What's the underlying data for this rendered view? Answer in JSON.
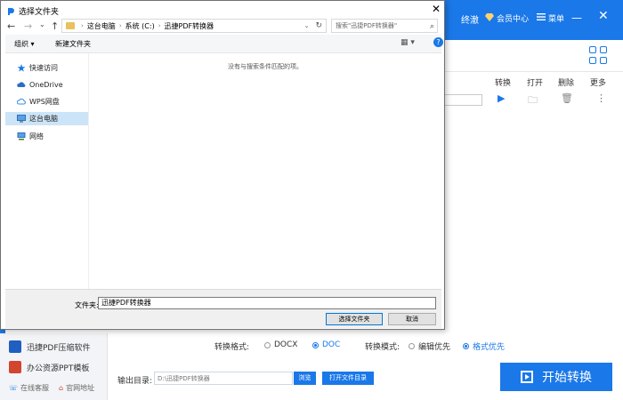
{
  "app": {
    "username": "终澈",
    "vip_label": "会员中心",
    "menu_label": "菜单",
    "minimize_glyph": "—",
    "close_glyph": "✕",
    "columns": [
      "转换",
      "打开",
      "删除",
      "更多"
    ],
    "row_actions": {
      "play": "▶",
      "open_folder": "🗀",
      "delete": "🗑",
      "more": "⋮"
    },
    "promos": [
      "迅捷PDF压缩软件",
      "办公资源PPT模板"
    ],
    "links": [
      "在线客服",
      "官网地址"
    ],
    "convert_format_label": "转换格式:",
    "convert_format_options": [
      {
        "label": "DOCX",
        "selected": false
      },
      {
        "label": "DOC",
        "selected": true
      }
    ],
    "convert_mode_label": "转换模式:",
    "convert_mode_options": [
      {
        "label": "编辑优先",
        "selected": false
      },
      {
        "label": "格式优先",
        "selected": true
      }
    ],
    "output_label": "输出目录:",
    "output_value": "D:\\迅捷PDF转换器",
    "browse_label": "浏览",
    "open_dir_label": "打开文件目录",
    "start_label": "开始转换",
    "accent_color": "#1a78e8"
  },
  "dialog": {
    "title": "选择文件夹",
    "close_glyph": "✕",
    "nav": {
      "back": "←",
      "forward": "→",
      "dropdown": "⌄",
      "up": "↑"
    },
    "breadcrumb": [
      "这台电脑",
      "系统 (C:)",
      "迅捷PDF转换器"
    ],
    "refresh_glyph": "↻",
    "search_placeholder": "搜索\"迅捷PDF转换器\"",
    "search_glyph": "⌕",
    "organize_label": "组织 ▾",
    "new_folder_label": "新建文件夹",
    "view_glyph": "▦ ▾",
    "help_glyph": "?",
    "nav_items": [
      {
        "label": "快速访问",
        "icon": "star-icon"
      },
      {
        "label": "OneDrive",
        "icon": "cloud-icon"
      },
      {
        "label": "WPS网盘",
        "icon": "wps-cloud-icon"
      },
      {
        "label": "这台电脑",
        "icon": "computer-icon"
      },
      {
        "label": "网络",
        "icon": "network-icon"
      }
    ],
    "empty_message": "没有与搜索条件匹配的项。",
    "filename_label": "文件夹:",
    "filename_value": "迅捷PDF转换器",
    "select_button": "选择文件夹",
    "cancel_button": "取消"
  }
}
